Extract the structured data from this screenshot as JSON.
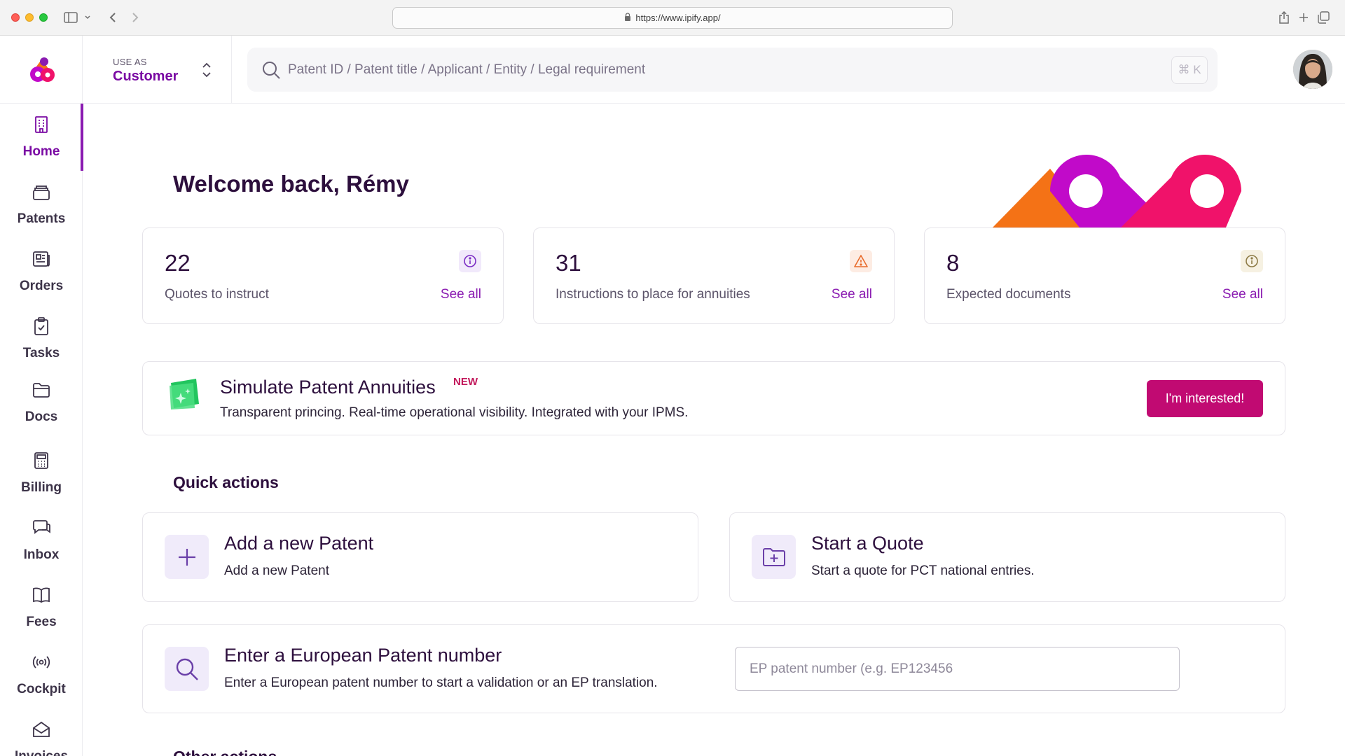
{
  "browser": {
    "url": "https://www.ipify.app/"
  },
  "header": {
    "use_as_caption": "USE AS",
    "use_as_value": "Customer",
    "search_placeholder": "Patent ID / Patent title / Applicant / Entity / Legal requirement",
    "shortcut": "⌘ K"
  },
  "sidebar": {
    "items": [
      {
        "label": "Home",
        "icon": "building-icon",
        "active": true
      },
      {
        "label": "Patents",
        "icon": "stack-icon"
      },
      {
        "label": "Orders",
        "icon": "newspaper-icon"
      },
      {
        "label": "Tasks",
        "icon": "clipboard-check-icon"
      },
      {
        "label": "Docs",
        "icon": "folder-icon"
      },
      {
        "label": "Billing",
        "icon": "calculator-icon"
      },
      {
        "label": "Inbox",
        "icon": "chat-icon"
      },
      {
        "label": "Fees",
        "icon": "book-icon"
      },
      {
        "label": "Cockpit",
        "icon": "broadcast-icon"
      },
      {
        "label": "Invoices",
        "icon": "mail-open-icon"
      }
    ]
  },
  "main": {
    "welcome": "Welcome back, Rémy",
    "stats": [
      {
        "value": "22",
        "label": "Quotes to instruct",
        "link": "See all",
        "icon": "info-icon"
      },
      {
        "value": "31",
        "label": "Instructions to place for annuities",
        "link": "See all",
        "icon": "warning-icon"
      },
      {
        "value": "8",
        "label": "Expected documents",
        "link": "See all",
        "icon": "info-icon"
      }
    ],
    "promo": {
      "title": "Simulate Patent Annuities",
      "badge": "NEW",
      "subtitle": "Transparent princing. Real-time operational visibility. Integrated with your IPMS.",
      "button": "I'm interested!"
    },
    "quick_actions_title": "Quick actions",
    "actions": [
      {
        "title": "Add a new Patent",
        "subtitle": "Add a new Patent",
        "icon": "plus-icon"
      },
      {
        "title": "Start a Quote",
        "subtitle": "Start a quote for PCT national entries.",
        "icon": "folder-plus-icon"
      }
    ],
    "ep": {
      "title": "Enter a European Patent number",
      "subtitle": "Enter a European patent number to start a validation or an EP translation.",
      "placeholder": "EP patent number (e.g. EP123456",
      "icon": "search-icon"
    },
    "other_actions_title": "Other actions"
  },
  "colors": {
    "accent": "#8a1bb1",
    "brand_button": "#c10a72",
    "brand_orange": "#f47216",
    "brand_magenta": "#c10ac9",
    "brand_pink": "#f0126a"
  }
}
